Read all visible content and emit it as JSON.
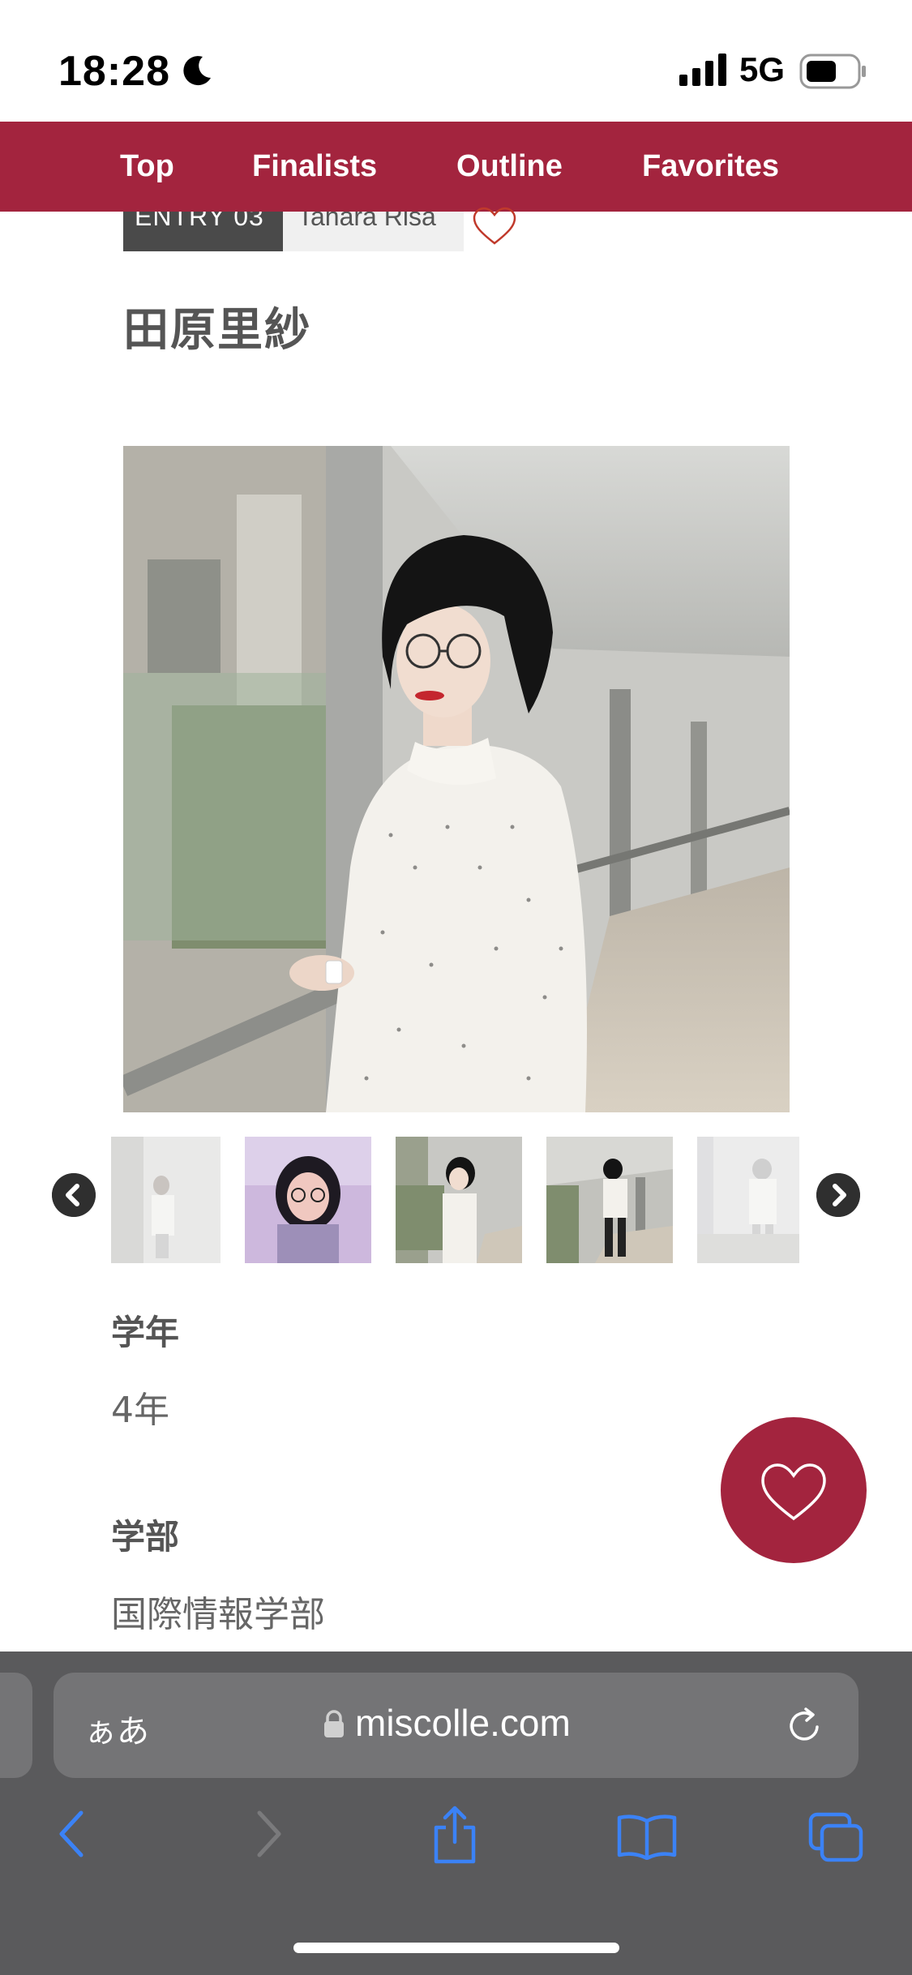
{
  "status_bar": {
    "time": "18:28",
    "network": "5G"
  },
  "nav": {
    "items": [
      "Top",
      "Finalists",
      "Outline",
      "Favorites"
    ]
  },
  "entry": {
    "tag": "ENTRY 03",
    "romaji": "Tahara Risa",
    "name": "田原里紗"
  },
  "details": [
    {
      "label": "学年",
      "value": "4年"
    },
    {
      "label": "学部",
      "value": "国際情報学部"
    }
  ],
  "browser": {
    "aa": "ぁあ",
    "url": "miscolle.com"
  },
  "colors": {
    "brand": "#a3243e",
    "toolbar_bg": "#5a5a5c",
    "accent_blue": "#3b82f6"
  },
  "icons": [
    "moon-icon",
    "signal-icon",
    "battery-icon",
    "heart-icon",
    "chevron-left-icon",
    "chevron-right-icon",
    "lock-icon",
    "reload-icon",
    "share-icon",
    "book-icon",
    "tabs-icon"
  ]
}
